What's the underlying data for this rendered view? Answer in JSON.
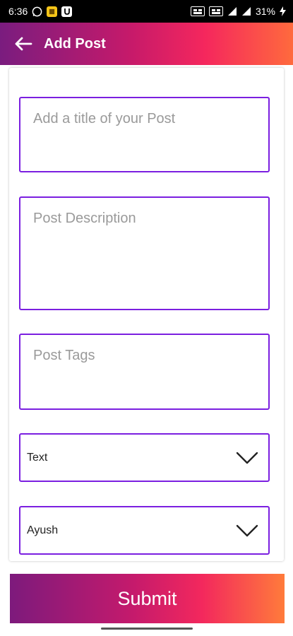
{
  "status_bar": {
    "time": "6:36",
    "battery": "31%",
    "icons": [
      "whatsapp-icon",
      "notification-box-icon",
      "app-u-icon",
      "vo-lte-icon",
      "vo-lte-icon",
      "signal-icon",
      "signal-icon",
      "charging-icon"
    ]
  },
  "header": {
    "title": "Add Post",
    "back_icon": "arrow-back-icon",
    "gradient": [
      "#7a1c7f",
      "#c71a6a",
      "#f5275d",
      "#ff6a3d"
    ]
  },
  "form": {
    "title_placeholder": "Add a title of your Post",
    "description_placeholder": "Post Description",
    "tags_placeholder": "Post Tags",
    "type_select": {
      "value": "Text"
    },
    "user_select": {
      "value": "Ayush"
    },
    "border_color": "#7b1fe0"
  },
  "submit": {
    "label": "Submit"
  }
}
